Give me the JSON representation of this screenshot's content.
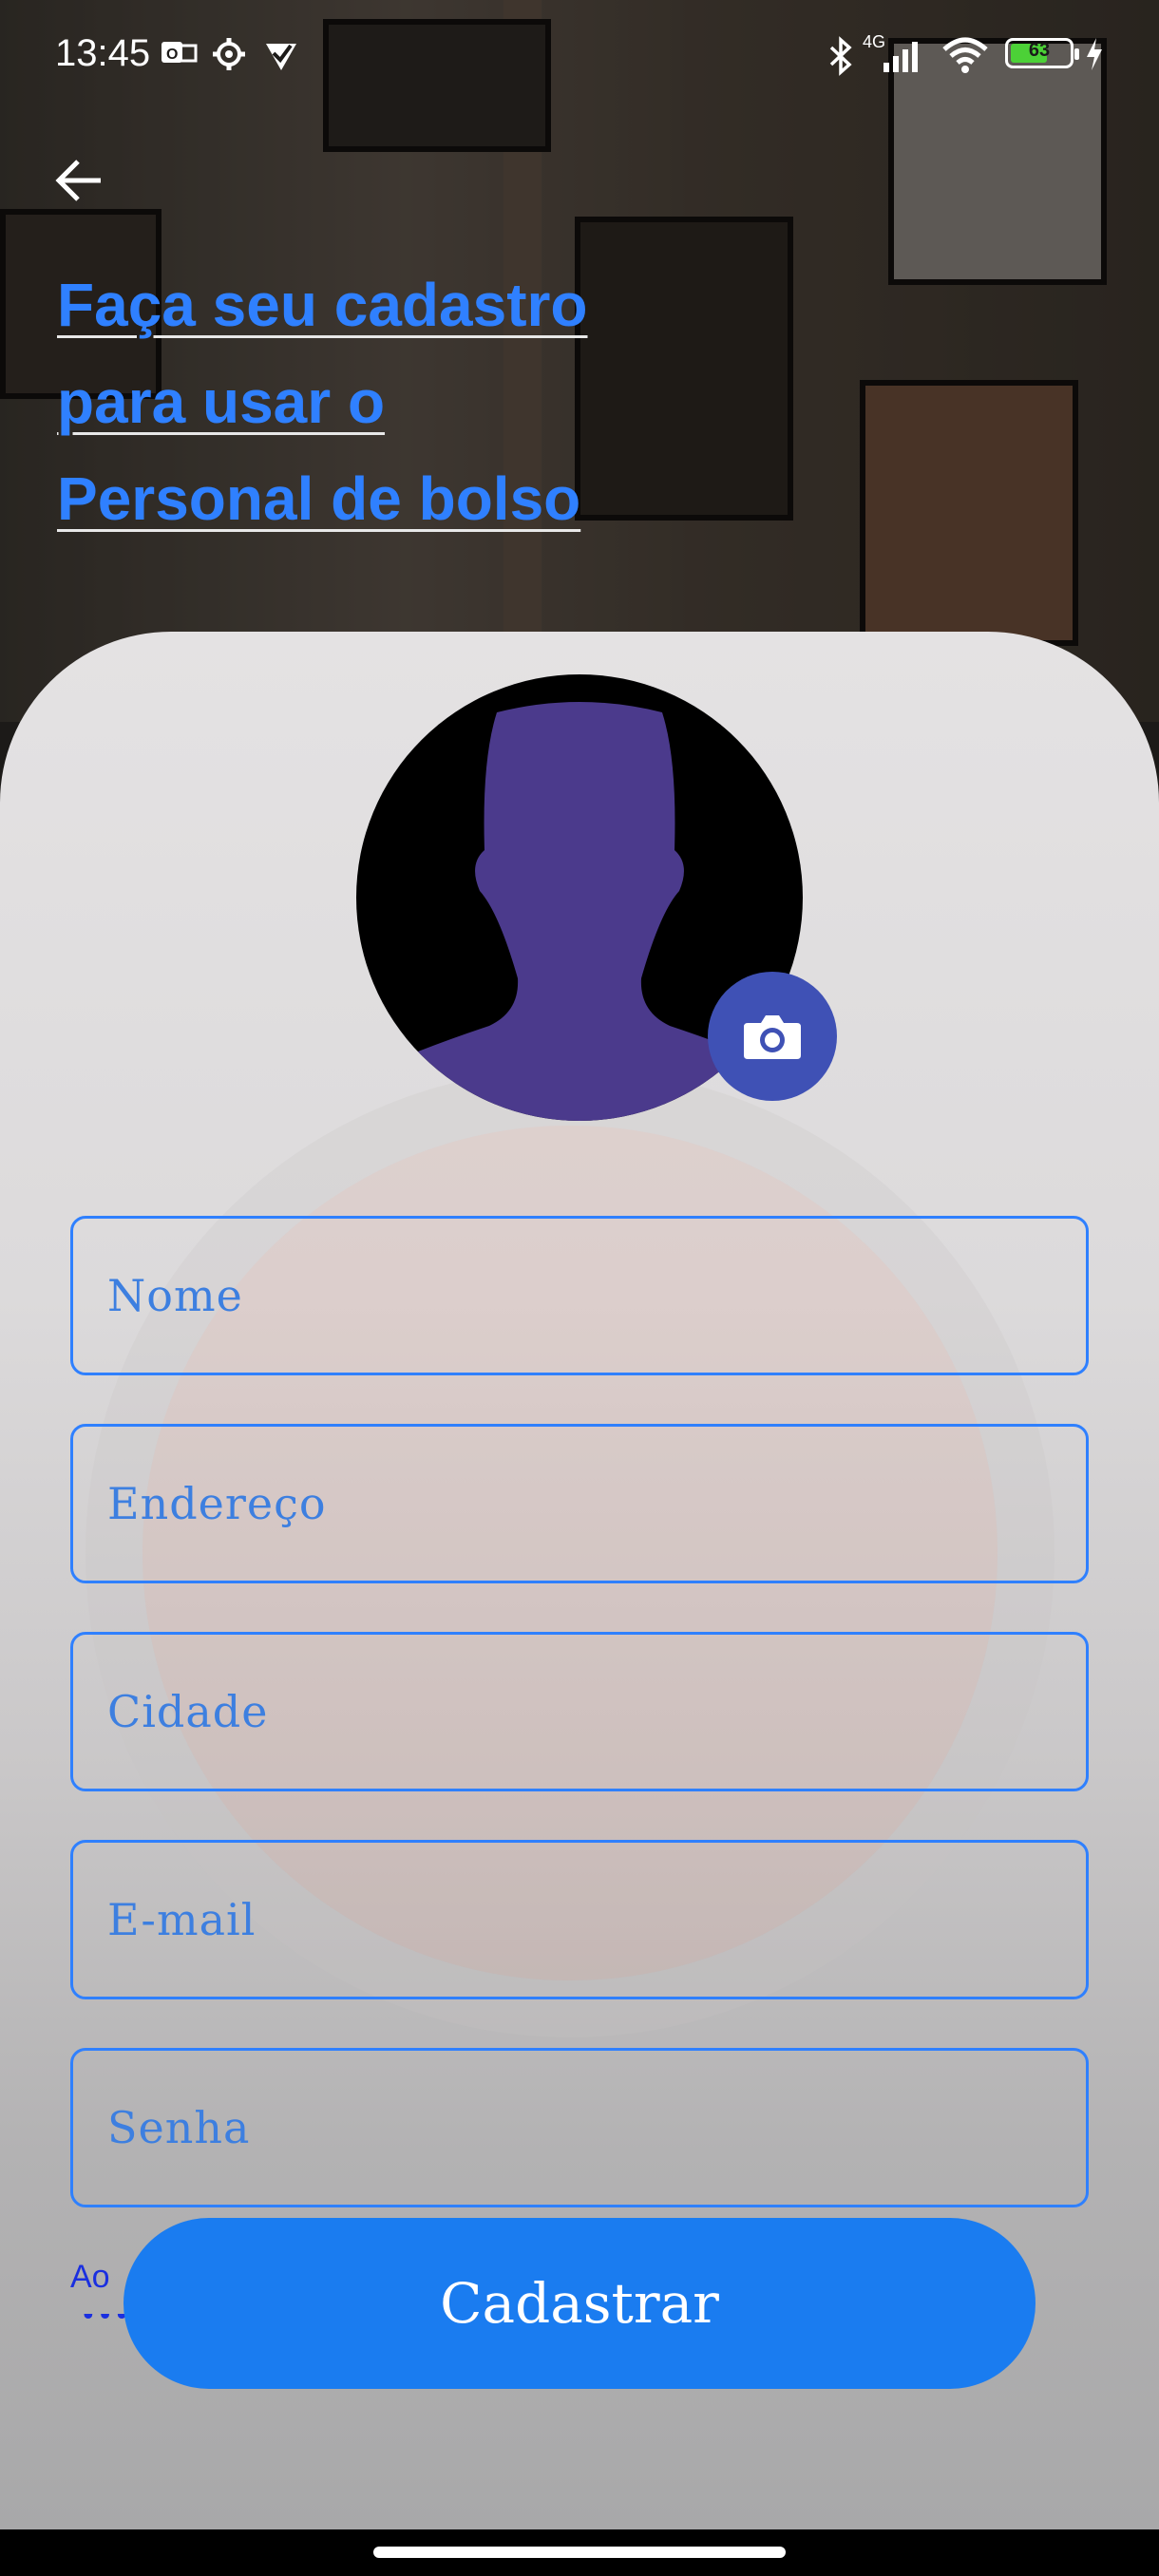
{
  "status_bar": {
    "time": "13:45",
    "network_label": "4G",
    "battery_level": 63,
    "battery_text": "63"
  },
  "header": {
    "title_lines": [
      "Faça seu cadastro",
      "para usar o",
      "Personal de bolso"
    ]
  },
  "form": {
    "fields": [
      {
        "placeholder": "Nome"
      },
      {
        "placeholder": "Endereço"
      },
      {
        "placeholder": "Cidade"
      },
      {
        "placeholder": "E-mail"
      },
      {
        "placeholder": "Senha"
      }
    ],
    "terms_text_visible": "Ao",
    "submit_label": "Cadastrar"
  },
  "colors": {
    "accent": "#2f80ff",
    "button": "#1a7cf0",
    "avatar_silhouette": "#4b3a8c",
    "camera_button": "#3f51b5"
  },
  "icons": [
    "back-arrow-icon",
    "camera-icon",
    "bluetooth-icon",
    "signal-icon",
    "wifi-icon",
    "battery-icon",
    "charging-icon",
    "settings-icon",
    "mail-icon",
    "check-icon"
  ]
}
